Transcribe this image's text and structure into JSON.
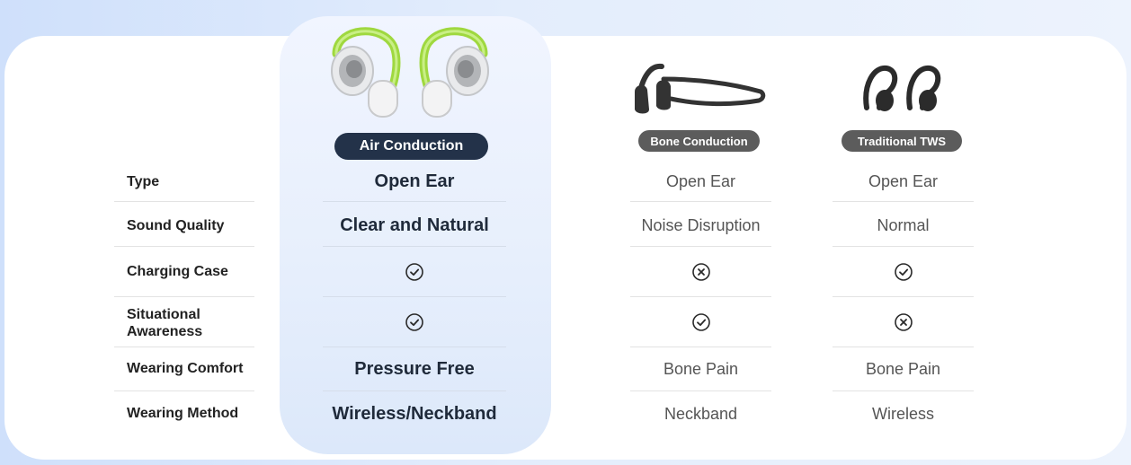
{
  "columns": {
    "air": {
      "badge": "Air Conduction"
    },
    "bone": {
      "badge": "Bone Conduction"
    },
    "tws": {
      "badge": "Traditional TWS"
    }
  },
  "rows": [
    {
      "label": "Type",
      "air": "Open Ear",
      "bone": "Open Ear",
      "tws": "Open Ear"
    },
    {
      "label": "Sound Quality",
      "air": "Clear and Natural",
      "bone": "Noise Disruption",
      "tws": "Normal"
    },
    {
      "label": "Charging Case",
      "air": "check-icon",
      "bone": "cross-icon",
      "tws": "check-icon"
    },
    {
      "label": "Situational Awareness",
      "air": "check-icon",
      "bone": "check-icon",
      "tws": "cross-icon"
    },
    {
      "label": "Wearing Comfort",
      "air": "Pressure Free",
      "bone": "Bone Pain",
      "tws": "Bone Pain"
    },
    {
      "label": "Wearing Method",
      "air": "Wireless/Neckband",
      "bone": "Neckband",
      "tws": "Wireless"
    }
  ],
  "colors": {
    "accent_green": "#9fd83f",
    "badge_dark": "#233249",
    "badge_gray": "#5c5c5c"
  }
}
